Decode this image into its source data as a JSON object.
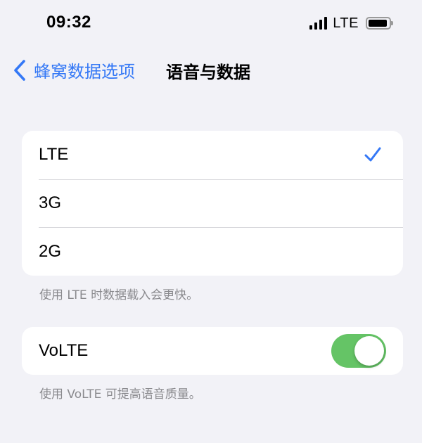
{
  "status_bar": {
    "time": "09:32",
    "network_type": "LTE",
    "signal_icon": "cellular-signal-icon",
    "battery_icon": "battery-icon"
  },
  "nav": {
    "back_label": "蜂窝数据选项",
    "title": "语音与数据"
  },
  "network_options": {
    "items": [
      {
        "label": "LTE",
        "selected": true
      },
      {
        "label": "3G",
        "selected": false
      },
      {
        "label": "2G",
        "selected": false
      }
    ],
    "note": "使用 LTE 时数据载入会更快。"
  },
  "volte": {
    "label": "VoLTE",
    "enabled": true,
    "note": "使用 VoLTE 可提高语音质量。"
  },
  "colors": {
    "accent": "#3478f6",
    "toggle_on": "#65c466",
    "background": "#f2f2f7",
    "secondary_text": "#8a8a8e"
  }
}
